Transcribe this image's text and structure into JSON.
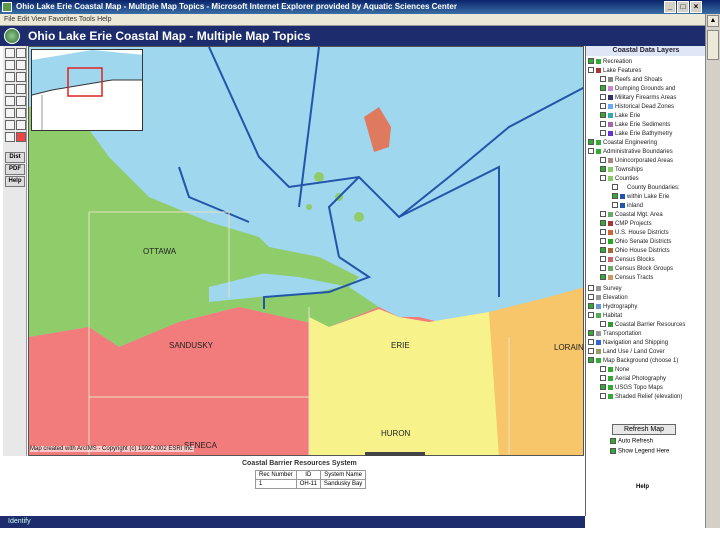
{
  "window": {
    "title": "Ohio Lake Erie Coastal Map - Multiple Map Topics - Microsoft Internet Explorer provided by Aquatic Sciences Center",
    "minimize": "_",
    "maximize": "□",
    "close": "×"
  },
  "menubar": {
    "text": "File   Edit   View   Favorites   Tools   Help"
  },
  "header": {
    "title": "Ohio Lake Erie Coastal Map - Multiple Map Topics"
  },
  "toolbar": {
    "buttons": [
      "Dist",
      "PDF",
      "Help"
    ]
  },
  "map": {
    "labels": {
      "ottawa": "OTTAWA",
      "sandusky": "SANDUSKY",
      "erie": "ERIE",
      "lorain": "LORAIN",
      "huron": "HURON",
      "seneca": "SENECA"
    },
    "copyright": "Map created with ArcIMS - Copyright (c) 1992-2002 ESRI Inc.",
    "colors": {
      "lake": "#9fd7ee",
      "ottawa": "#8fcc6a",
      "sandusky": "#f27b7b",
      "huron": "#f7f28a",
      "lorain": "#f7c66a",
      "pink": "#e37bd8"
    }
  },
  "results": {
    "title": "Coastal Barrier Resources System",
    "headers": [
      "Rec Number",
      "ID",
      "System Name"
    ],
    "rows": [
      [
        "1",
        "OH-11",
        "Sandusky Bay"
      ]
    ]
  },
  "status": {
    "text": "Identify"
  },
  "layers": {
    "heading": "Coastal Data Layers",
    "items": [
      "Recreation",
      "Lake Features",
      "Reefs and Shoals",
      "Dumping Grounds and",
      "Military Firearms Areas",
      "Historical Dead Zones",
      "Lake Erie",
      "Lake Erie Sediments",
      "Lake Erie Bathymetry",
      "Coastal Engineering",
      "Administrative Boundaries",
      "Unincorporated Areas",
      "Townships",
      "Counties",
      "County Boundaries:",
      "within Lake Erie",
      "inland",
      "Coastal Mgt. Area",
      "CMP Projects",
      "U.S. House Districts",
      "Ohio Senate Districts",
      "Ohio House Districts",
      "Census Blocks",
      "Census Block Groups",
      "Census Tracts",
      "Survey",
      "Elevation",
      "Hydrography",
      "Habitat",
      "Coastal Barrier Resources",
      "Transportation",
      "Navigation and Shipping",
      "Land Use / Land Cover",
      "Map Background (choose 1)",
      "None",
      "Aerial Photography",
      "USGS Topo Maps",
      "Shaded Relief (elevation)"
    ],
    "refresh": "Refresh Map",
    "auto_refresh": "Auto Refresh",
    "show_legend": "Show Legend Here",
    "help_label": "Help"
  }
}
